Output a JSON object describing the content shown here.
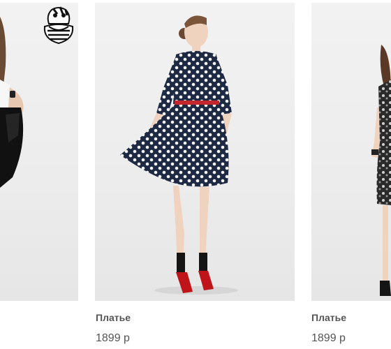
{
  "products": [
    {
      "title": "",
      "price": "",
      "photo_icon": "woman-black-dress-photo"
    },
    {
      "title": "Платье",
      "price": "1899 р",
      "photo_icon": "polka-dot-dress-photo"
    },
    {
      "title": "Платье",
      "price": "1899 р",
      "photo_icon": "floral-dress-photo"
    }
  ],
  "badge_icon": "cheshire-cat-icon"
}
